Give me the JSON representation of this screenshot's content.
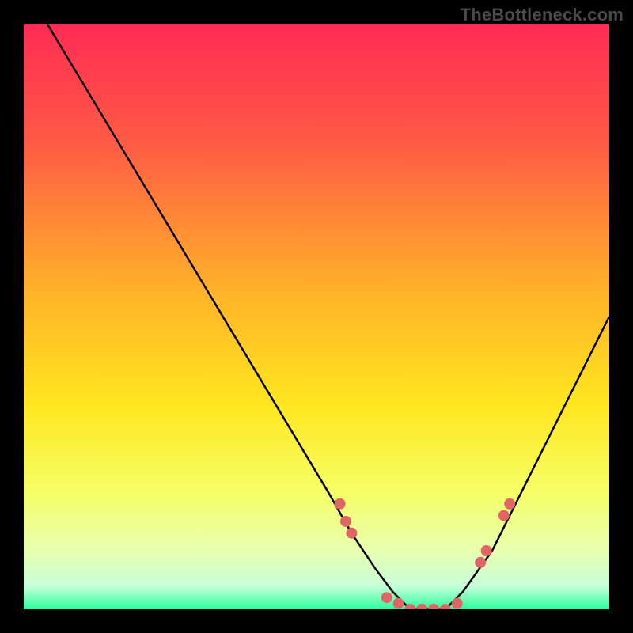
{
  "attribution": "TheBottleneck.com",
  "chart_data": {
    "type": "line",
    "title": "",
    "xlabel": "",
    "ylabel": "",
    "xlim": [
      0,
      100
    ],
    "ylim": [
      0,
      100
    ],
    "background_gradient": {
      "stops": [
        {
          "offset": 0.0,
          "color": "#ff2b55"
        },
        {
          "offset": 0.2,
          "color": "#ff5a45"
        },
        {
          "offset": 0.45,
          "color": "#ffb02a"
        },
        {
          "offset": 0.65,
          "color": "#ffe61f"
        },
        {
          "offset": 0.8,
          "color": "#f6ff66"
        },
        {
          "offset": 0.9,
          "color": "#e8ffb0"
        },
        {
          "offset": 0.96,
          "color": "#c8ffd8"
        },
        {
          "offset": 1.0,
          "color": "#2bff9d"
        }
      ]
    },
    "series": [
      {
        "name": "bottleneck-curve",
        "type": "line",
        "color": "#000000",
        "x": [
          4,
          10,
          16,
          22,
          28,
          34,
          40,
          46,
          52,
          56,
          60,
          63,
          66,
          69,
          72,
          75,
          80,
          85,
          90,
          95,
          100
        ],
        "y": [
          100,
          90,
          80,
          70,
          60,
          50,
          40,
          30,
          20,
          13,
          7,
          3,
          0,
          0,
          0,
          3,
          10,
          20,
          30,
          40,
          50
        ]
      },
      {
        "name": "marker-dots",
        "type": "scatter",
        "color": "#e06666",
        "x": [
          54,
          55,
          56,
          62,
          64,
          66,
          68,
          70,
          72,
          74,
          78,
          79,
          82,
          83
        ],
        "y": [
          18,
          15,
          13,
          2,
          1,
          0,
          0,
          0,
          0,
          1,
          8,
          10,
          16,
          18
        ]
      }
    ]
  }
}
